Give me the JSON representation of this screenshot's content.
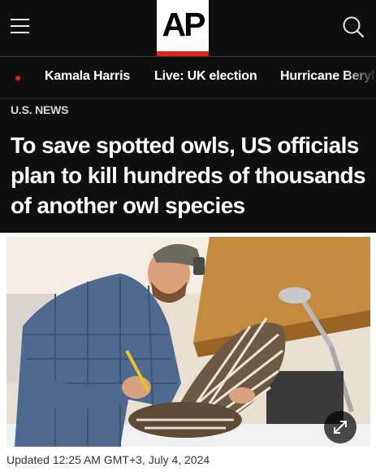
{
  "header": {
    "logo_text": "AP",
    "menu_icon": "hamburger-menu-icon",
    "search_icon": "search-icon"
  },
  "trending": {
    "items": [
      "Kamala Harris",
      "Live: UK election",
      "Hurricane Beryl"
    ]
  },
  "article": {
    "section": "U.S. NEWS",
    "headline": "To save spotted owls, US officials plan to kill hundreds of thousands of another owl species",
    "updated": "Updated 12:25 AM GMT+3, July 4, 2024"
  },
  "photo": {
    "expand_icon": "expand-arrows-icon"
  },
  "colors": {
    "background_dark": "#0f0f0f",
    "accent_red": "#e2231a",
    "text_white": "#ffffff"
  }
}
